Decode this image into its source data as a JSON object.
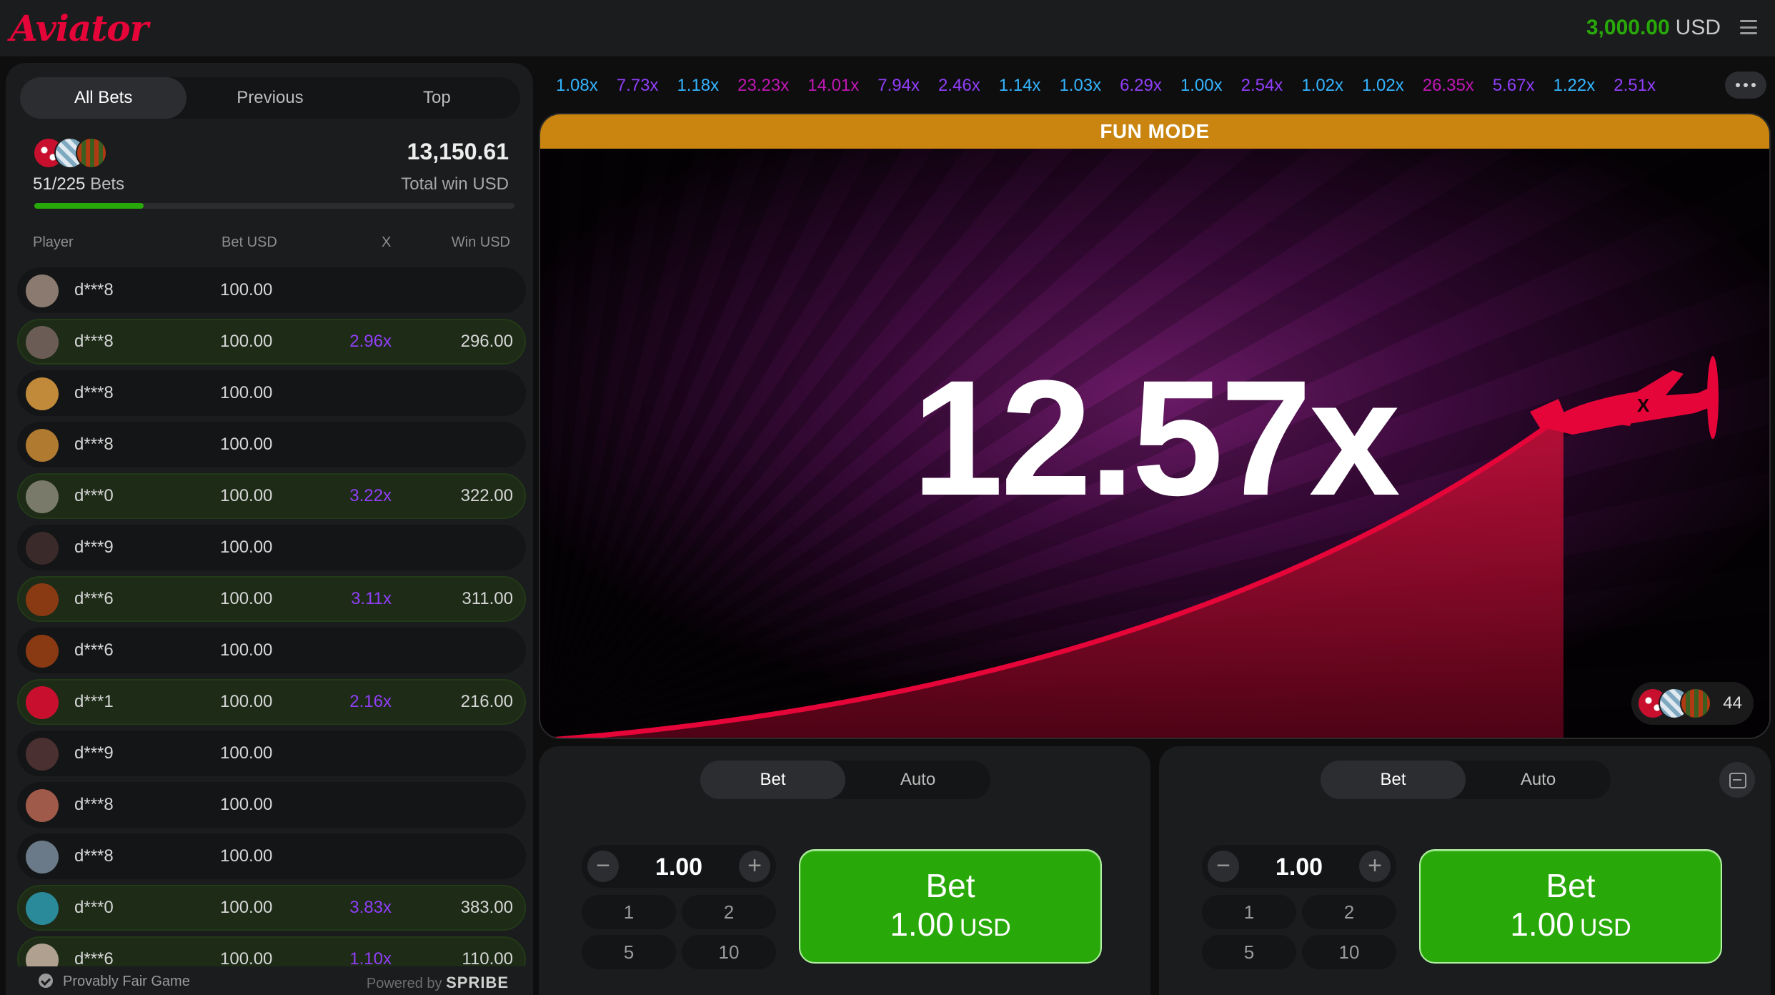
{
  "header": {
    "logo": "Aviator",
    "balance": "3,000.00",
    "currency": "USD"
  },
  "left": {
    "tabs": [
      "All Bets",
      "Previous",
      "Top"
    ],
    "bets_count": "51/225",
    "bets_label": "Bets",
    "total_win": "13,150.61",
    "total_win_label": "Total win USD",
    "progress": 0.227,
    "columns": {
      "player": "Player",
      "bet": "Bet USD",
      "x": "X",
      "win": "Win USD"
    },
    "rows": [
      {
        "name": "d***8",
        "bet": "100.00",
        "mult": "",
        "win": "",
        "win_state": false
      },
      {
        "name": "d***8",
        "bet": "100.00",
        "mult": "2.96x",
        "win": "296.00",
        "win_state": true
      },
      {
        "name": "d***8",
        "bet": "100.00",
        "mult": "",
        "win": "",
        "win_state": false
      },
      {
        "name": "d***8",
        "bet": "100.00",
        "mult": "",
        "win": "",
        "win_state": false
      },
      {
        "name": "d***0",
        "bet": "100.00",
        "mult": "3.22x",
        "win": "322.00",
        "win_state": true
      },
      {
        "name": "d***9",
        "bet": "100.00",
        "mult": "",
        "win": "",
        "win_state": false
      },
      {
        "name": "d***6",
        "bet": "100.00",
        "mult": "3.11x",
        "win": "311.00",
        "win_state": true
      },
      {
        "name": "d***6",
        "bet": "100.00",
        "mult": "",
        "win": "",
        "win_state": false
      },
      {
        "name": "d***1",
        "bet": "100.00",
        "mult": "2.16x",
        "win": "216.00",
        "win_state": true
      },
      {
        "name": "d***9",
        "bet": "100.00",
        "mult": "",
        "win": "",
        "win_state": false
      },
      {
        "name": "d***8",
        "bet": "100.00",
        "mult": "",
        "win": "",
        "win_state": false
      },
      {
        "name": "d***8",
        "bet": "100.00",
        "mult": "",
        "win": "",
        "win_state": false
      },
      {
        "name": "d***0",
        "bet": "100.00",
        "mult": "3.83x",
        "win": "383.00",
        "win_state": true
      },
      {
        "name": "d***6",
        "bet": "100.00",
        "mult": "1.10x",
        "win": "110.00",
        "win_state": true
      }
    ],
    "footer": {
      "fair": "Provably Fair Game",
      "powered": "Powered by",
      "brand": "SPRIBE"
    }
  },
  "history": [
    {
      "v": "1.08x",
      "c": "#34b4ff"
    },
    {
      "v": "7.73x",
      "c": "#913ef8"
    },
    {
      "v": "1.18x",
      "c": "#34b4ff"
    },
    {
      "v": "23.23x",
      "c": "#c017b4"
    },
    {
      "v": "14.01x",
      "c": "#c017b4"
    },
    {
      "v": "7.94x",
      "c": "#913ef8"
    },
    {
      "v": "2.46x",
      "c": "#913ef8"
    },
    {
      "v": "1.14x",
      "c": "#34b4ff"
    },
    {
      "v": "1.03x",
      "c": "#34b4ff"
    },
    {
      "v": "6.29x",
      "c": "#913ef8"
    },
    {
      "v": "1.00x",
      "c": "#34b4ff"
    },
    {
      "v": "2.54x",
      "c": "#913ef8"
    },
    {
      "v": "1.02x",
      "c": "#34b4ff"
    },
    {
      "v": "1.02x",
      "c": "#34b4ff"
    },
    {
      "v": "26.35x",
      "c": "#c017b4"
    },
    {
      "v": "5.67x",
      "c": "#913ef8"
    },
    {
      "v": "1.22x",
      "c": "#34b4ff"
    },
    {
      "v": "2.51x",
      "c": "#913ef8"
    }
  ],
  "game": {
    "banner": "FUN MODE",
    "multiplier": "12.57x",
    "players_count": "44"
  },
  "panels": [
    {
      "tabs": [
        "Bet",
        "Auto"
      ],
      "amount": "1.00",
      "quick": [
        "1",
        "2",
        "5",
        "10"
      ],
      "btn_title": "Bet",
      "btn_amount": "1.00",
      "btn_currency": "USD"
    },
    {
      "tabs": [
        "Bet",
        "Auto"
      ],
      "amount": "1.00",
      "quick": [
        "1",
        "2",
        "5",
        "10"
      ],
      "btn_title": "Bet",
      "btn_amount": "1.00",
      "btn_currency": "USD"
    }
  ],
  "colors": {
    "accent_red": "#e50539",
    "win_green": "#28a909",
    "fun_mode": "#c9850f",
    "mult_purple": "#913ef8"
  },
  "icons": [
    "menu-icon",
    "shield-check-icon",
    "more-dots-icon",
    "minus-icon",
    "plus-icon",
    "collapse-icon",
    "plane-icon"
  ]
}
